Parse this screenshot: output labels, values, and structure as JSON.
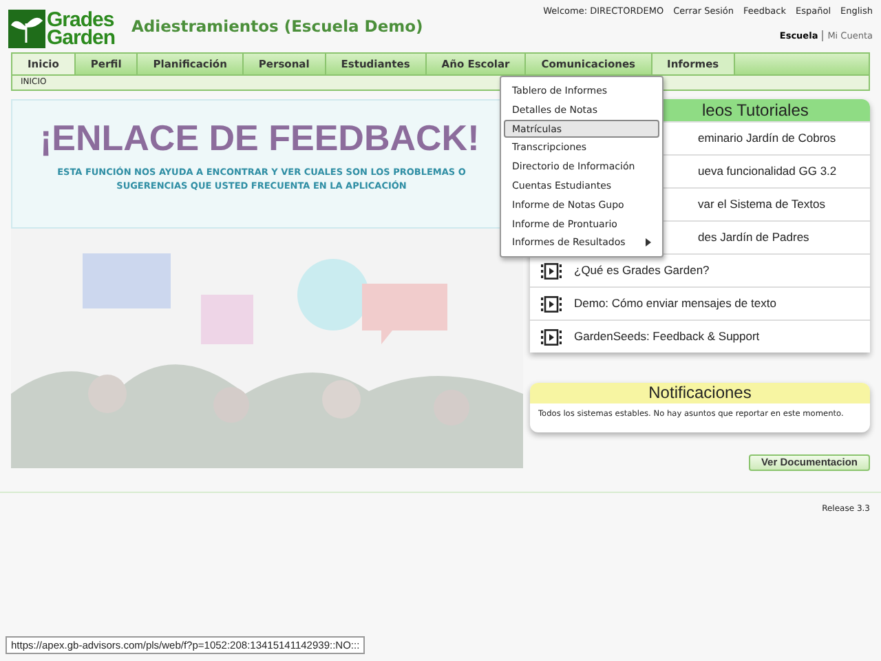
{
  "logo": {
    "line_1": "Grades",
    "line_2": "Garden"
  },
  "school_title": "Adiestramientos (Escuela Demo)",
  "welcome": "Welcome: DIRECTORDEMO",
  "top_links": [
    "Cerrar Sesión",
    "Feedback",
    "Español",
    "English"
  ],
  "account_links": [
    {
      "label": "Escuela",
      "selected": true
    },
    {
      "label": "Mi Cuenta",
      "selected": false
    }
  ],
  "tabs": [
    {
      "label": "Inicio",
      "selected": true
    },
    {
      "label": "Perfil",
      "selected": false
    },
    {
      "label": "Planificación",
      "selected": false
    },
    {
      "label": "Personal",
      "selected": false
    },
    {
      "label": "Estudiantes",
      "selected": false
    },
    {
      "label": "Año Escolar",
      "selected": false
    },
    {
      "label": "Comunicaciones",
      "selected": false
    },
    {
      "label": "Informes",
      "selected": false,
      "open": true
    }
  ],
  "breadcrumb": "INICIO",
  "banner": {
    "title": "¡ENLACE DE FEEDBACK!",
    "subtitle": "ESTA FUNCIÓN NOS AYUDA A ENCONTRAR Y VER CUALES SON LOS PROBLEMAS O SUGERENCIAS QUE USTED FRECUENTA EN LA APLICACIÓN"
  },
  "informes_menu": [
    {
      "label": "Tablero de Informes",
      "selected": false
    },
    {
      "label": "Detalles de Notas",
      "selected": false
    },
    {
      "label": "Matrículas",
      "selected": true
    },
    {
      "label": "Transcripciones",
      "selected": false
    },
    {
      "label": "Directorio de Información",
      "selected": false
    },
    {
      "label": "Cuentas Estudiantes",
      "selected": false
    },
    {
      "label": "Informe de Notas Gupo",
      "selected": false
    },
    {
      "label": "Informe de Prontuario",
      "selected": false
    },
    {
      "label": "Informes de Resultados",
      "selected": false,
      "submenu": true
    }
  ],
  "videos": {
    "title": "leos Tutoriales",
    "items": [
      {
        "label": "eminario Jardín de Cobros",
        "kind": "covered"
      },
      {
        "label": "ueva funcionalidad GG 3.2",
        "kind": "covered"
      },
      {
        "label": "var el Sistema de Textos",
        "kind": "covered"
      },
      {
        "label": "des Jardín de Padres",
        "kind": "covered"
      },
      {
        "label": "¿Qué es Grades Garden?",
        "kind": "full"
      },
      {
        "label": "Demo: Cómo enviar mensajes de texto",
        "kind": "full"
      },
      {
        "label": "GardenSeeds: Feedback & Support",
        "kind": "full"
      }
    ]
  },
  "notifications": {
    "title": "Notificaciones",
    "message": "Todos los sistemas estables. No hay asuntos que reportar en este momento."
  },
  "doc_button": "Ver Documentacion",
  "release": "Release 3.3",
  "status_url": "https://apex.gb-advisors.com/pls/web/f?p=1052:208:13415141142939::NO:::"
}
